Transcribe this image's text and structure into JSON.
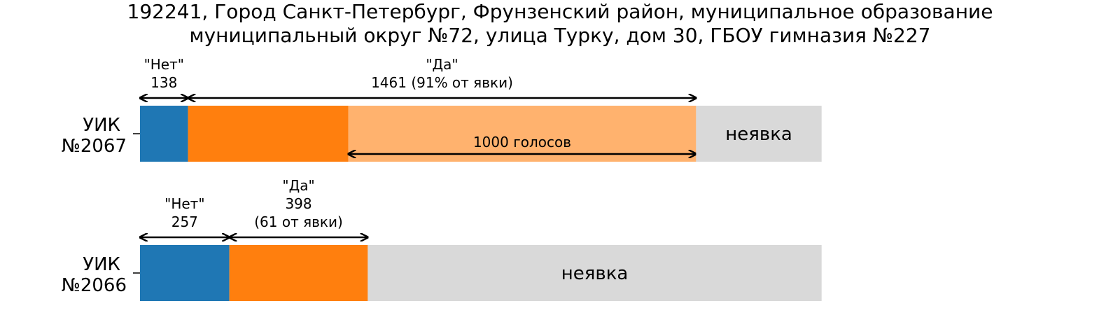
{
  "chart_data": {
    "type": "bar",
    "orientation": "horizontal",
    "stacked": true,
    "title_lines": [
      "192241, Город Санкт-Петербург, Фрунзенский район, муниципальное образование",
      "муниципальный округ №72, улица Турку, дом 30, ГБОУ гимназия №227"
    ],
    "categories": [
      [
        "УИК",
        "№2067"
      ],
      [
        "УИК",
        "№2066"
      ]
    ],
    "x_range": [
      0,
      2500
    ],
    "grid": false,
    "legend": "none",
    "colors": {
      "no": "#1f77b4",
      "yes": "#ff7f0e",
      "yes_light": "#ffb26e",
      "absent": "#d9d9d9"
    },
    "bars": [
      {
        "no": 138,
        "yes": 1461,
        "yes_excess": 1000,
        "total": 1960,
        "annotations": {
          "no_lines": [
            "\"Нет\"",
            "138"
          ],
          "yes_lines": [
            "\"Да\"",
            "1461 (91% от явки)"
          ],
          "excess_label": "1000 голосов",
          "absent_label": "неявка"
        }
      },
      {
        "no": 257,
        "yes": 398,
        "total": 1960,
        "annotations": {
          "no_lines": [
            "\"Нет\"",
            "257"
          ],
          "yes_lines": [
            "\"Да\"",
            "398",
            "(61 от явки)"
          ],
          "absent_label": "неявка"
        }
      }
    ]
  }
}
